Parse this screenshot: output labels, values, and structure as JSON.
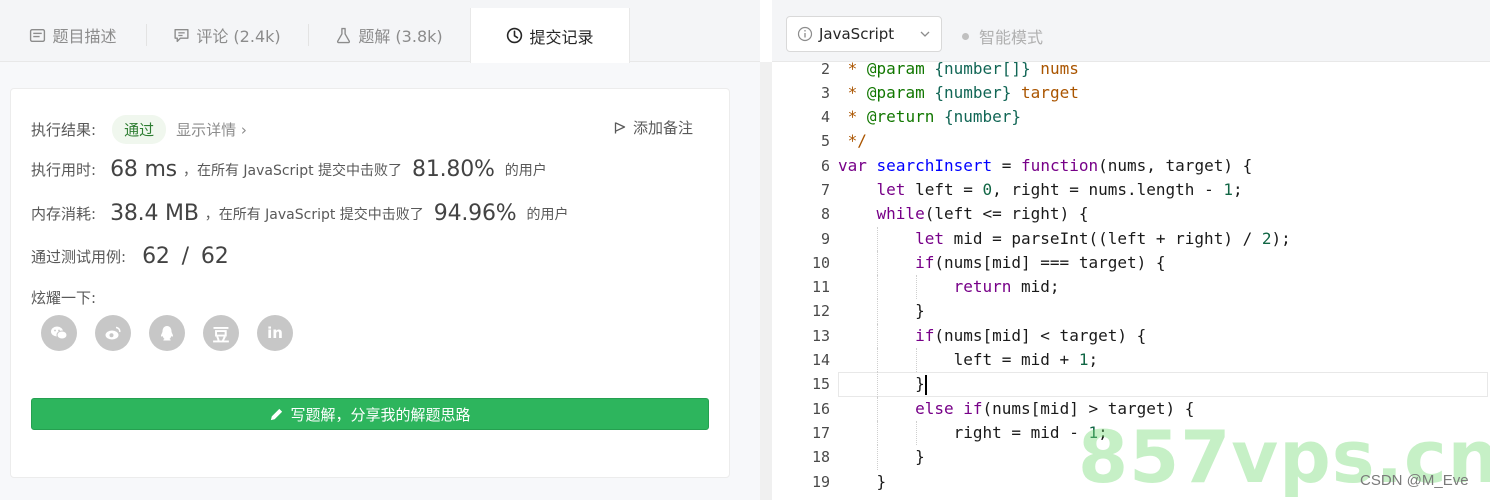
{
  "tabs": [
    {
      "label": "题目描述",
      "icon": "description-icon"
    },
    {
      "label": "评论 (2.4k)",
      "icon": "comment-icon"
    },
    {
      "label": "题解 (3.8k)",
      "icon": "flask-icon"
    },
    {
      "label": "提交记录",
      "icon": "clock-icon"
    }
  ],
  "result": {
    "label": "执行结果:",
    "status": "通过",
    "detail_link": "显示详情 ›",
    "add_note": "添加备注"
  },
  "runtime": {
    "label": "执行用时:",
    "value": "68 ms",
    "mid": "，在所有 JavaScript 提交中击败了",
    "percent": "81.80%",
    "suffix": "的用户"
  },
  "memory": {
    "label": "内存消耗:",
    "value": "38.4 MB",
    "mid": "，在所有 JavaScript 提交中击败了",
    "percent": "94.96%",
    "suffix": "的用户"
  },
  "testcases": {
    "label": "通过测试用例:",
    "passed": "62",
    "sep": "/",
    "total": "62"
  },
  "share": {
    "label": "炫耀一下:",
    "icons": [
      "wechat-icon",
      "weibo-icon",
      "qq-icon",
      "douban-icon",
      "linkedin-icon"
    ],
    "douban_glyph": "豆",
    "linkedin_glyph": "in"
  },
  "write_button": "写题解，分享我的解题思路",
  "editor": {
    "language": "JavaScript",
    "smart_mode": "智能模式",
    "line_numbers": [
      "2",
      "3",
      "4",
      "5",
      "6",
      "7",
      "8",
      "9",
      "10",
      "11",
      "12",
      "13",
      "14",
      "15",
      "16",
      "17",
      "18",
      "19"
    ],
    "current_line": "15"
  },
  "watermark": "857vps.cn",
  "credit": "CSDN @M_Eve",
  "colors": {
    "accent_green": "#2db55d",
    "pass_text": "#2e7d32"
  }
}
